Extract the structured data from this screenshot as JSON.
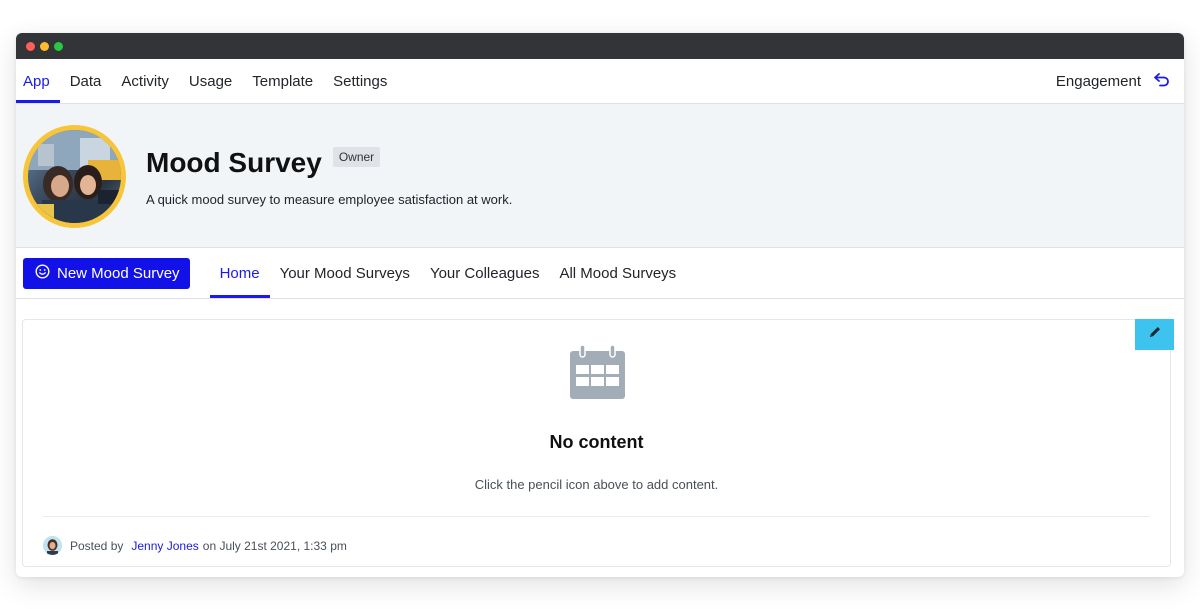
{
  "window": {
    "dots": [
      "#ff5f57",
      "#febc2e",
      "#28c840"
    ]
  },
  "topnav": {
    "items": [
      "App",
      "Data",
      "Activity",
      "Usage",
      "Template",
      "Settings"
    ],
    "active": "App",
    "workspace_label": "Engagement"
  },
  "header": {
    "title": "Mood Survey",
    "badge": "Owner",
    "description": "A quick mood survey to measure employee satisfaction at work."
  },
  "subnav": {
    "new_button_label": "New Mood Survey",
    "tabs": [
      "Home",
      "Your Mood Surveys",
      "Your Colleagues",
      "All Mood Surveys"
    ],
    "active": "Home"
  },
  "content": {
    "empty_title": "No content",
    "empty_subtitle": "Click the pencil icon above to add content.",
    "footer": {
      "posted_by_prefix": "Posted by",
      "author": "Jenny Jones",
      "date_text": "on July 21st 2021, 1:33 pm"
    }
  },
  "colors": {
    "accent": "#1a1aef",
    "primary_button": "#1212e8",
    "edit_button": "#3ec3ef",
    "avatar_ring": "#f7c53a",
    "header_bg": "#f2f5f8"
  },
  "icons": {
    "back": "return-arrow-icon",
    "new_button": "smiley-icon",
    "edit": "pencil-icon",
    "empty": "calendar-icon"
  }
}
